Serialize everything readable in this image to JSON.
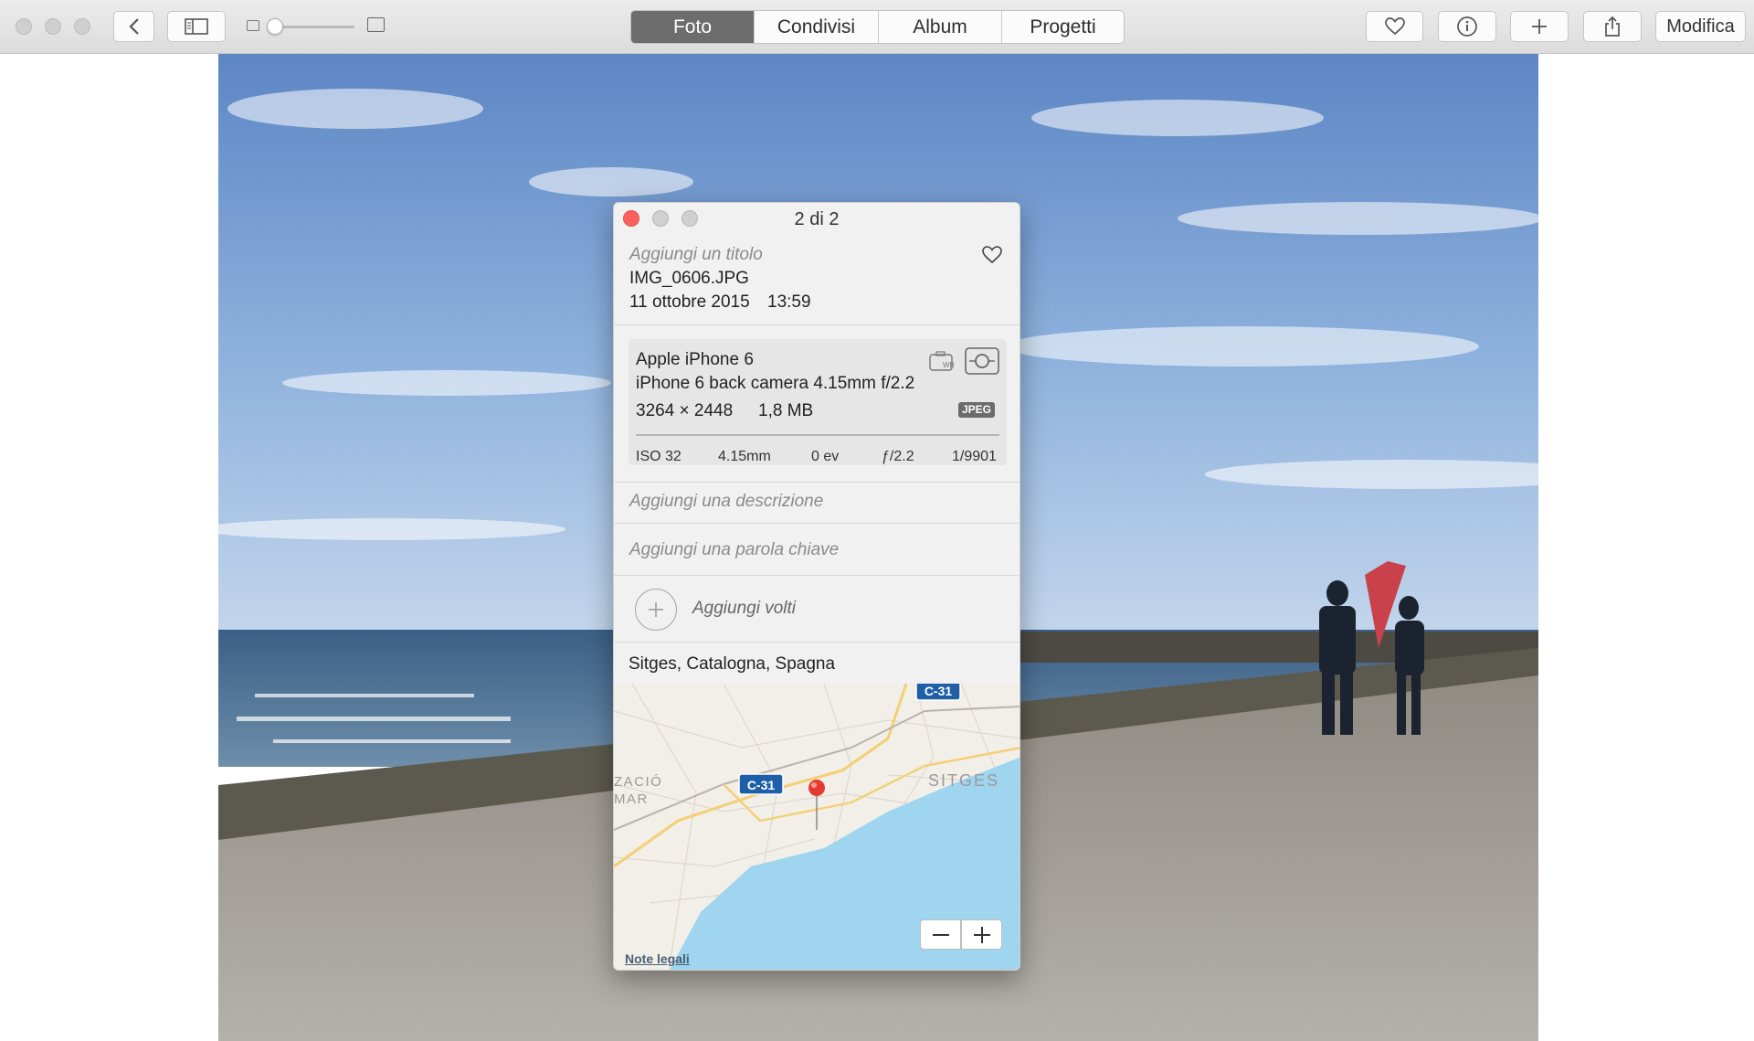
{
  "toolbar": {
    "tabs": [
      {
        "label": "Foto",
        "active": true
      },
      {
        "label": "Condivisi",
        "active": false
      },
      {
        "label": "Album",
        "active": false
      },
      {
        "label": "Progetti",
        "active": false
      }
    ],
    "edit_label": "Modifica",
    "icons": [
      "back-chevron-icon",
      "sidebar-icon",
      "heart-icon",
      "info-icon",
      "plus-icon",
      "share-icon"
    ]
  },
  "info_panel": {
    "title": "2 di 2",
    "add_title_placeholder": "Aggiungi un titolo",
    "filename": "IMG_0606.JPG",
    "date": "11 ottobre 2015",
    "time": "13:59",
    "camera": {
      "model": "Apple iPhone 6",
      "lens": "iPhone 6 back camera 4.15mm f/2.2",
      "dimensions": "3264 × 2448",
      "size": "1,8 MB",
      "format": "JPEG",
      "iso": "ISO 32",
      "focal": "4.15mm",
      "ev": "0 ev",
      "aperture": "ƒ/2.2",
      "shutter": "1/9901"
    },
    "description_placeholder": "Aggiungi una descrizione",
    "keyword_placeholder": "Aggiungi una parola chiave",
    "faces_label": "Aggiungi volti",
    "location": "Sitges, Catalogna, Spagna",
    "map": {
      "road_label_top": "C-31",
      "road_label_mid": "C-31",
      "town_label": "SITGES",
      "partial_label_1": "ZACIÓ",
      "partial_label_2": "MAR",
      "legal_link": "Note legali"
    }
  },
  "colors": {
    "close_red": "#fc605c",
    "tab_active_bg": "#6d6d6d",
    "sea": "#9fd5ef",
    "pin": "#e53a2f",
    "road_badge": "#1f5fa8"
  }
}
